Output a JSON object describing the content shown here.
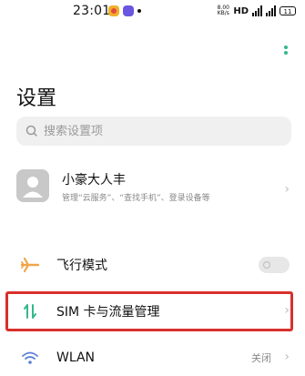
{
  "status_bar": {
    "time": "23:01",
    "net_speed": "8.00\nKB/s",
    "hd": "HD",
    "signal_label": "4G",
    "battery": "11"
  },
  "page": {
    "title": "设置"
  },
  "search": {
    "placeholder": "搜索设置项"
  },
  "account": {
    "name": "小豪大人丰",
    "subtitle": "管理“云服务”、“查找手机”、登录设备等"
  },
  "rows": [
    {
      "label": "飞行模式",
      "icon": "airplane-icon",
      "toggle_on": false
    },
    {
      "label": "SIM 卡与流量管理",
      "icon": "sim-data-icon",
      "highlighted": true
    },
    {
      "label": "WLAN",
      "icon": "wifi-icon",
      "value": "关闭"
    }
  ],
  "colors": {
    "accent_green": "#34b88a",
    "highlight_red": "#d9302c",
    "airplane_orange": "#f0a64a"
  }
}
